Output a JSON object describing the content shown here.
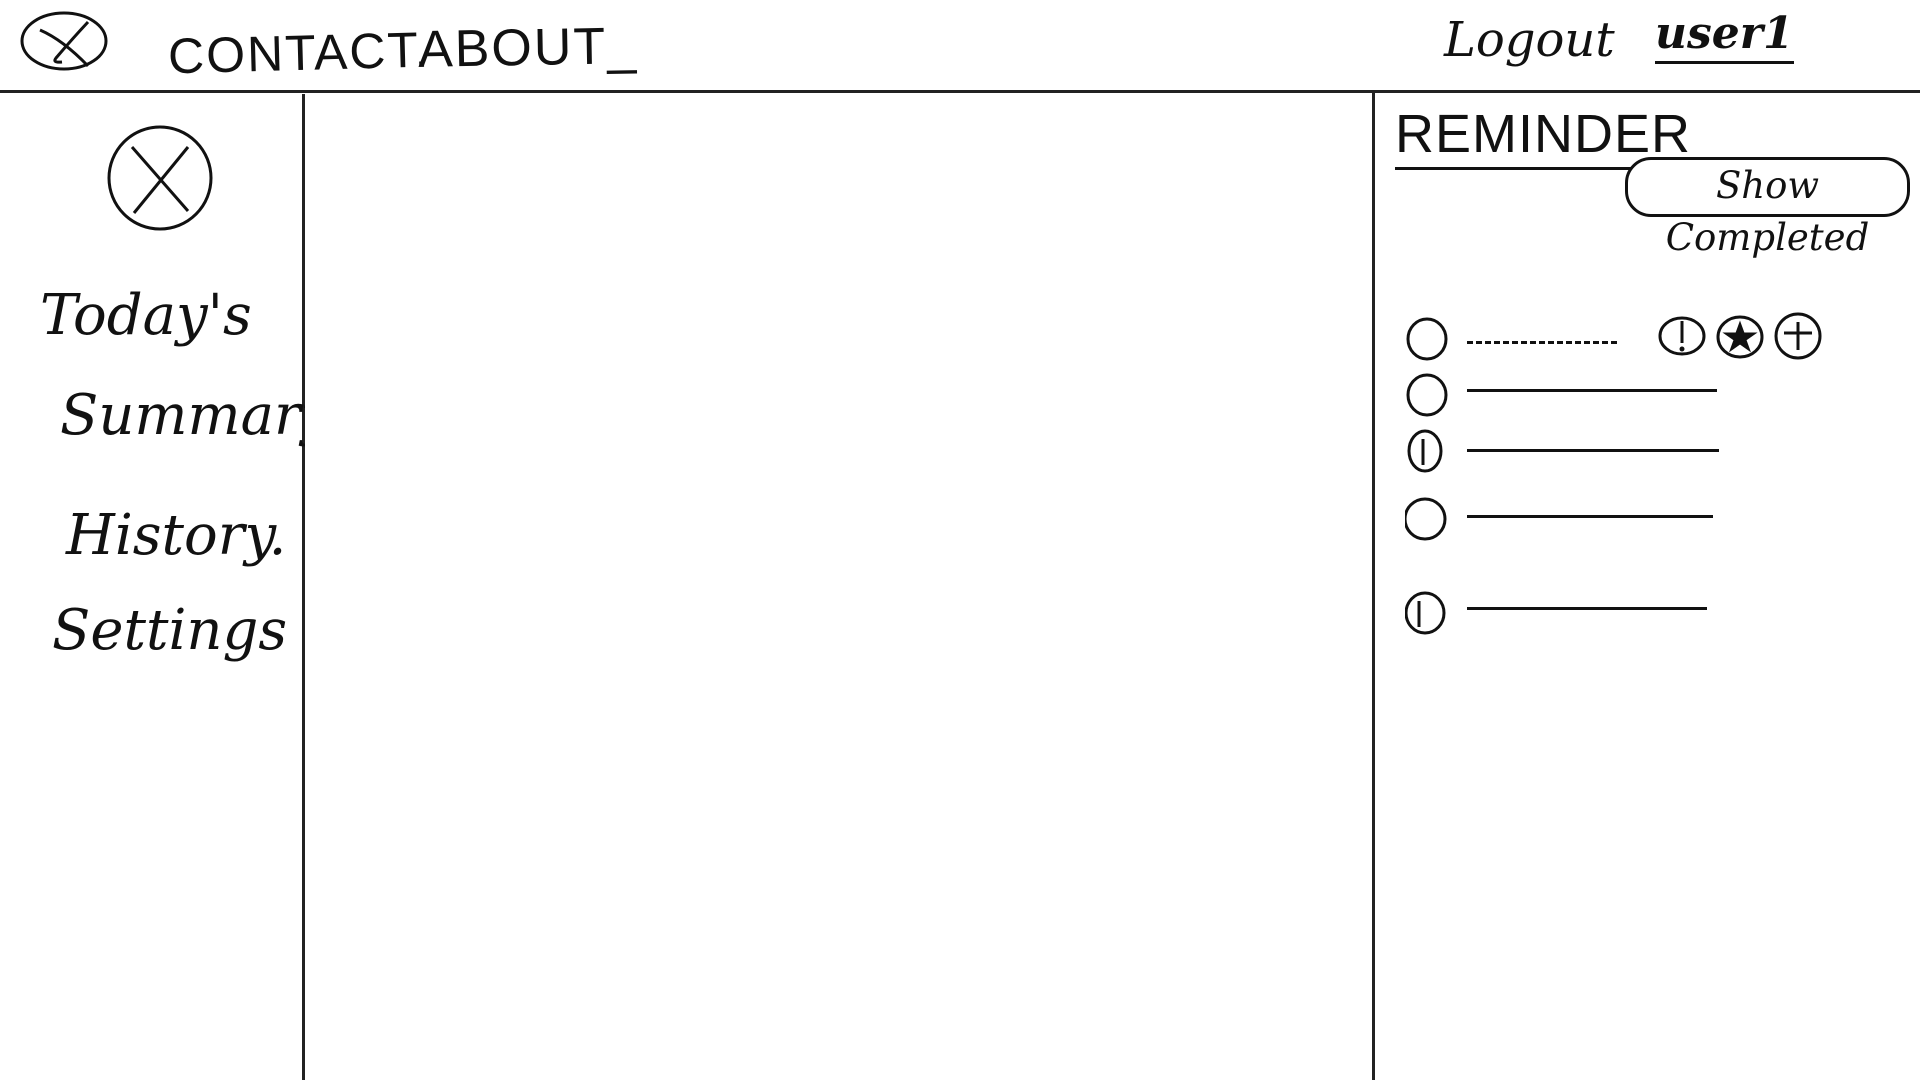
{
  "header": {
    "nav": {
      "contact_label": "CONTACT.",
      "about_label": "ABOUT_"
    },
    "logout_label": "Logout",
    "user_label": "user1"
  },
  "sidebar": {
    "items": [
      {
        "label": "Today's"
      },
      {
        "label": "Summary"
      },
      {
        "label": "History."
      },
      {
        "label": "Settings"
      }
    ]
  },
  "reminder": {
    "title": "REMINDER",
    "show_completed_label": "Show Completed",
    "items": [
      {
        "state": "editing",
        "actions": [
          "alert-icon",
          "star-icon",
          "add-icon"
        ]
      },
      {
        "state": "unchecked"
      },
      {
        "state": "unchecked"
      },
      {
        "state": "unchecked"
      },
      {
        "state": "unchecked"
      }
    ]
  },
  "colors": {
    "ink": "#111111",
    "background": "#ffffff"
  }
}
